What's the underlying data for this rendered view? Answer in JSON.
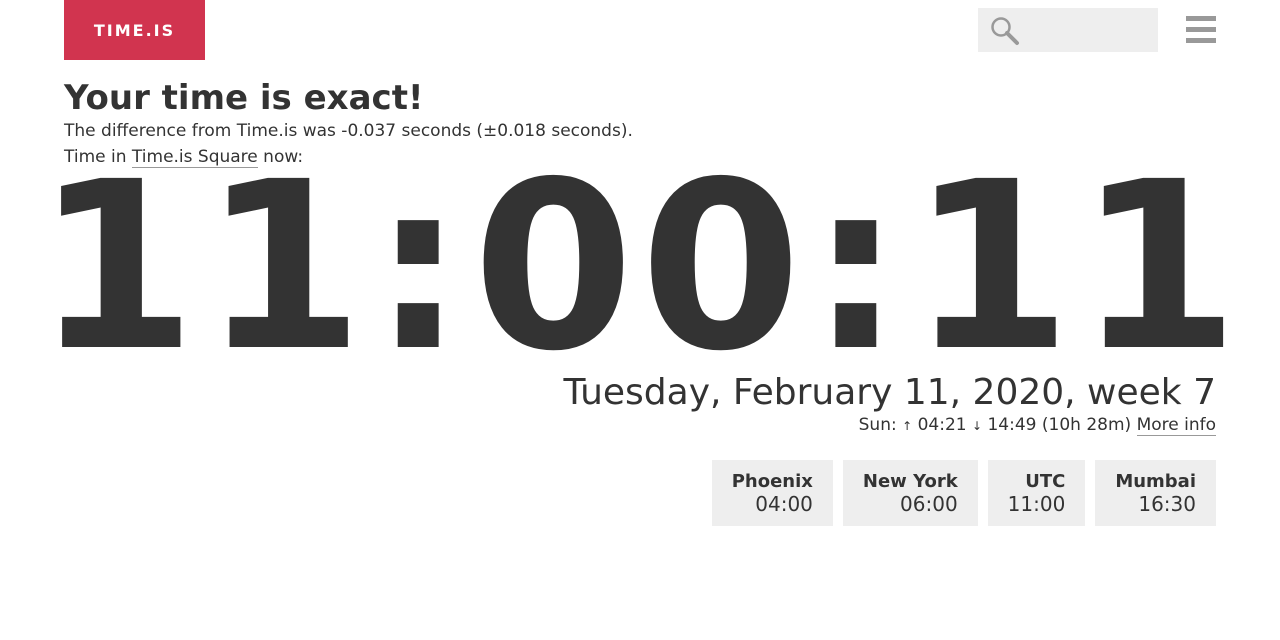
{
  "header": {
    "logo": "TIME.IS",
    "search": {
      "value": "",
      "placeholder": ""
    },
    "menu_icon": "hamburger-menu-icon",
    "search_icon": "magnifier-icon"
  },
  "main": {
    "heading": "Your time is exact!",
    "difference_text": "The difference from Time.is was -0.037 seconds (±0.018 seconds).",
    "time_in_prefix": "Time in ",
    "time_in_link": "Time.is Square",
    "time_in_suffix": " now:",
    "clock": {
      "hours": "11",
      "minutes": "00",
      "seconds": "11",
      "separator": ":"
    },
    "date": "Tuesday, February 11, 2020, week 7",
    "sun": {
      "label": "Sun: ",
      "sunrise_arrow": "↑",
      "sunrise": "04:21",
      "sunset_arrow": "↓",
      "sunset": "14:49",
      "day_length": "(10h 28m)",
      "more_info": "More info"
    }
  },
  "cities": [
    {
      "name": "Phoenix",
      "time": "04:00"
    },
    {
      "name": "New York",
      "time": "06:00"
    },
    {
      "name": "UTC",
      "time": "11:00"
    },
    {
      "name": "Mumbai",
      "time": "16:30"
    }
  ],
  "colors": {
    "brand": "#d1344f",
    "text": "#333333",
    "panel": "#eeeeee"
  }
}
